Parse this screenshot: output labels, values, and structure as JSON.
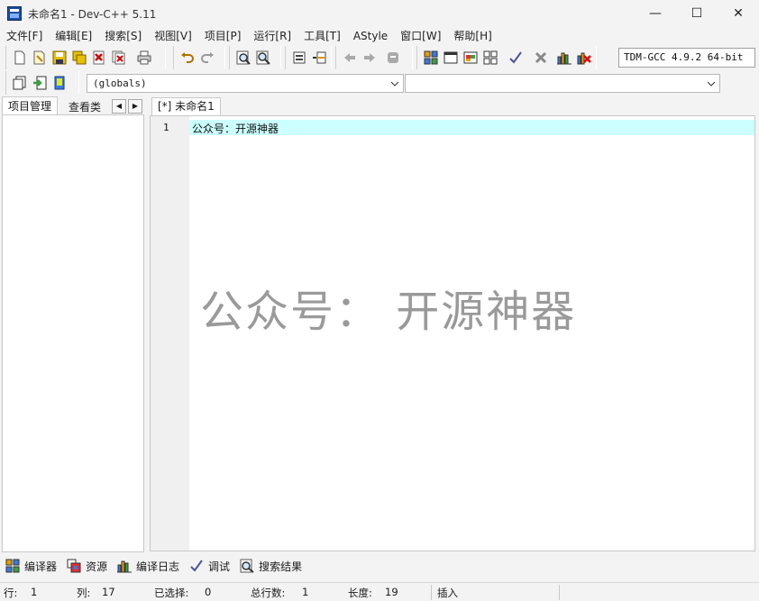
{
  "window": {
    "title": "未命名1 - Dev-C++ 5.11",
    "controls": {
      "minimize": "—",
      "maximize": "☐",
      "close": "✕"
    }
  },
  "menu": [
    "文件[F]",
    "编辑[E]",
    "搜索[S]",
    "视图[V]",
    "项目[P]",
    "运行[R]",
    "工具[T]",
    "AStyle",
    "窗口[W]",
    "帮助[H]"
  ],
  "toolbar": {
    "compiler": "TDM-GCC 4.9.2 64-bit"
  },
  "scope_bar": {
    "scope_value": "(globals)",
    "member_value": ""
  },
  "left_panel": {
    "tabs": [
      "项目管理",
      "查看类"
    ],
    "scroll_left": "◀",
    "scroll_right": "▶"
  },
  "editor": {
    "tab_label": "[*] 未命名1",
    "line_number": "1",
    "code_line": "公众号：开源神器"
  },
  "watermark": "公众号： 开源神器",
  "bottom_tabs": [
    "编译器",
    "资源",
    "编译日志",
    "调试",
    "搜索结果"
  ],
  "status": {
    "row_label": "行:",
    "row_value": "1",
    "col_label": "列:",
    "col_value": "17",
    "sel_label": "已选择:",
    "sel_value": "0",
    "lines_label": "总行数:",
    "lines_value": "1",
    "len_label": "长度:",
    "len_value": "19",
    "mode": "插入"
  },
  "colors": {
    "current_line": "#ccffff",
    "gutter": "#f0f0f0",
    "watermark": "#9a9a9a"
  }
}
